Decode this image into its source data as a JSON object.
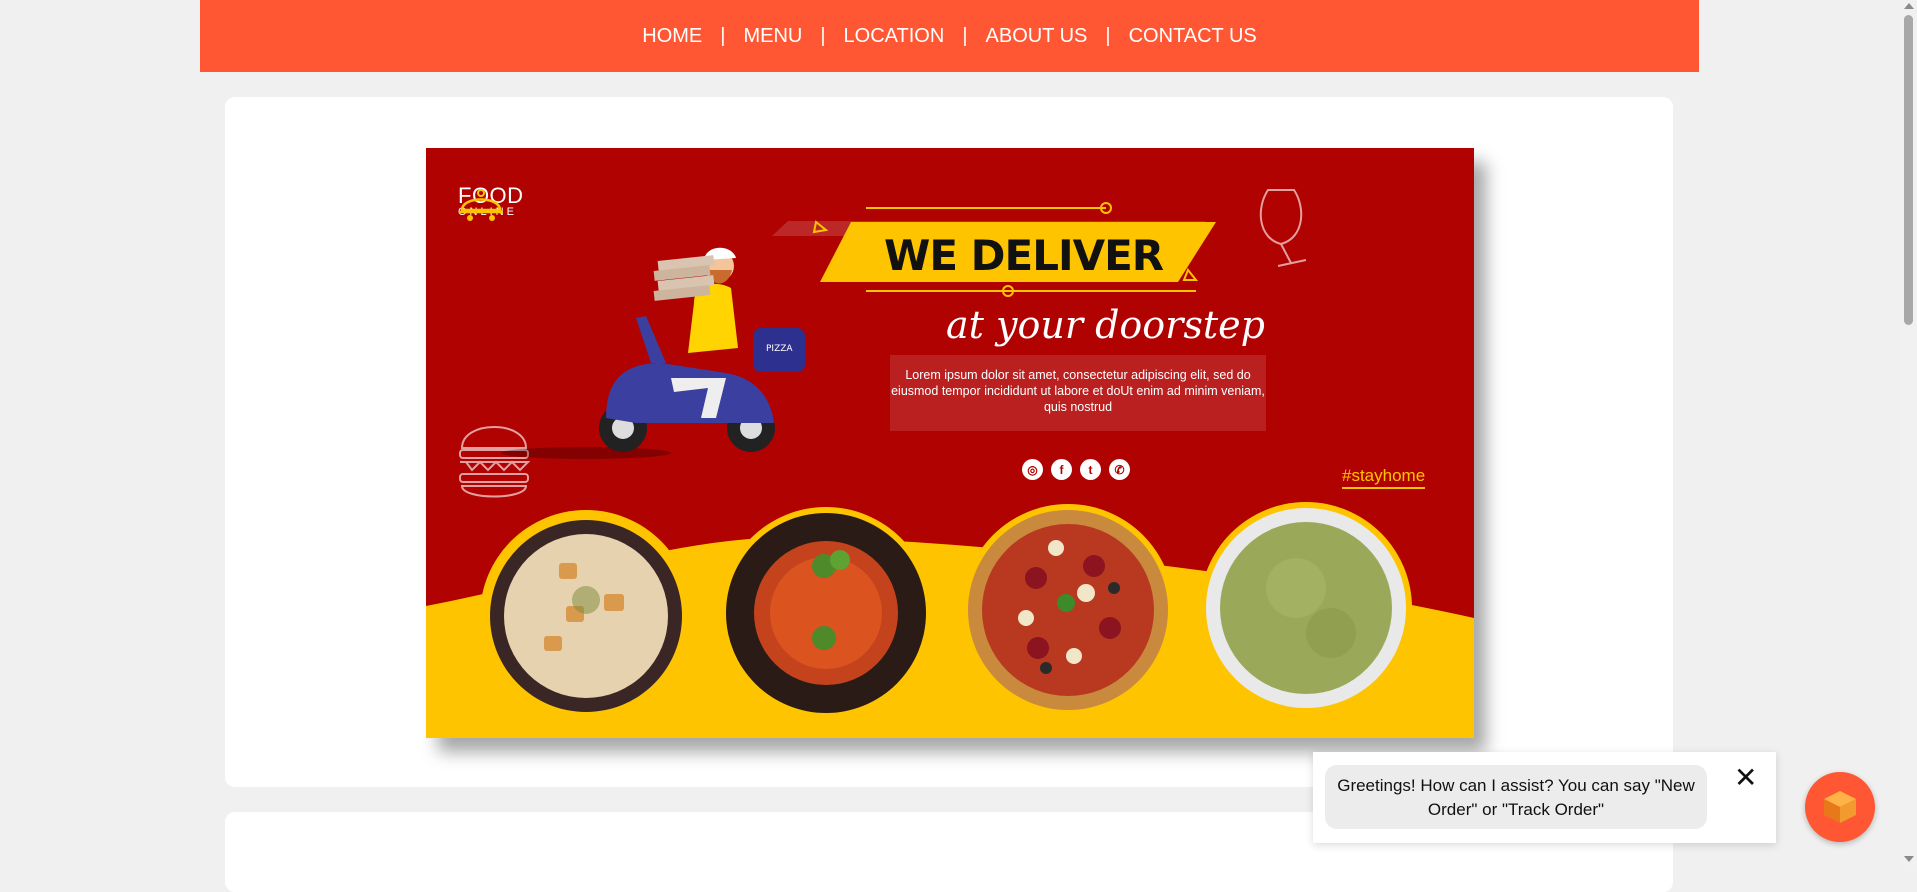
{
  "nav": {
    "items": [
      "HOME",
      "MENU",
      "LOCATION",
      "ABOUT US",
      "CONTACT US"
    ],
    "separator": "|",
    "background": "#ff5733"
  },
  "banner": {
    "brand_title": "FOOD",
    "brand_subtitle": "ONLINE",
    "headline": "WE DELIVER",
    "tagline": "at your doorstep",
    "body": "Lorem ipsum dolor sit amet, consectetur adipiscing elit, sed do eiusmod tempor incididunt ut labore et doUt enim ad minim veniam, quis nostrud",
    "box_label": "PIZZA",
    "hashtag": "#stayhome",
    "social_icons": [
      "instagram-icon",
      "facebook-icon",
      "twitter-icon",
      "whatsapp-icon"
    ],
    "dishes": [
      "soup-bowl",
      "spaghetti-plate",
      "pizza",
      "green-soup-bowl"
    ],
    "colors": {
      "red": "#b10202",
      "yellow": "#ffc400"
    }
  },
  "chat": {
    "message": "Greetings! How can I assist? You can say \"New Order\" or \"Track Order\"",
    "close_label": "✕"
  }
}
